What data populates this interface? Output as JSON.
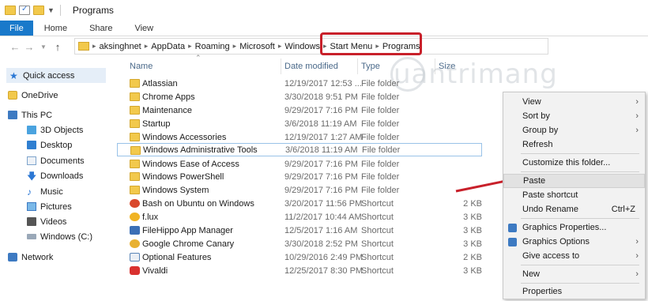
{
  "window": {
    "title": "Programs"
  },
  "ribbon": {
    "tabs": [
      "File",
      "Home",
      "Share",
      "View"
    ]
  },
  "address": {
    "crumbs": [
      "aksinghnet",
      "AppData",
      "Roaming",
      "Microsoft",
      "Windows",
      "Start Menu",
      "Programs"
    ]
  },
  "sidebar": {
    "items": [
      {
        "label": "Quick access",
        "icon": "star-icon"
      },
      {
        "label": "OneDrive",
        "icon": "onedrive-icon"
      },
      {
        "label": "This PC",
        "icon": "pc-icon"
      },
      {
        "label": "3D Objects",
        "icon": "cube-icon"
      },
      {
        "label": "Desktop",
        "icon": "desktop-icon"
      },
      {
        "label": "Documents",
        "icon": "documents-icon"
      },
      {
        "label": "Downloads",
        "icon": "download-icon"
      },
      {
        "label": "Music",
        "icon": "music-icon"
      },
      {
        "label": "Pictures",
        "icon": "pictures-icon"
      },
      {
        "label": "Videos",
        "icon": "videos-icon"
      },
      {
        "label": "Windows (C:)",
        "icon": "drive-icon"
      },
      {
        "label": "Network",
        "icon": "network-icon"
      }
    ]
  },
  "columns": {
    "name": "Name",
    "date": "Date modified",
    "type": "Type",
    "size": "Size"
  },
  "files": [
    {
      "name": "Atlassian",
      "date": "12/19/2017 12:53 ...",
      "type": "File folder",
      "size": ""
    },
    {
      "name": "Chrome Apps",
      "date": "3/30/2018 9:51 PM",
      "type": "File folder",
      "size": ""
    },
    {
      "name": "Maintenance",
      "date": "9/29/2017 7:16 PM",
      "type": "File folder",
      "size": ""
    },
    {
      "name": "Startup",
      "date": "3/6/2018 11:19 AM",
      "type": "File folder",
      "size": ""
    },
    {
      "name": "Windows Accessories",
      "date": "12/19/2017 1:27 AM",
      "type": "File folder",
      "size": ""
    },
    {
      "name": "Windows Administrative Tools",
      "date": "3/6/2018 11:19 AM",
      "type": "File folder",
      "size": ""
    },
    {
      "name": "Windows Ease of Access",
      "date": "9/29/2017 7:16 PM",
      "type": "File folder",
      "size": ""
    },
    {
      "name": "Windows PowerShell",
      "date": "9/29/2017 7:16 PM",
      "type": "File folder",
      "size": ""
    },
    {
      "name": "Windows System",
      "date": "9/29/2017 7:16 PM",
      "type": "File folder",
      "size": ""
    },
    {
      "name": "Bash on Ubuntu on Windows",
      "date": "3/20/2017 11:56 PM",
      "type": "Shortcut",
      "size": "2 KB"
    },
    {
      "name": "f.lux",
      "date": "11/2/2017 10:44 AM",
      "type": "Shortcut",
      "size": "3 KB"
    },
    {
      "name": "FileHippo App Manager",
      "date": "12/5/2017 1:16 AM",
      "type": "Shortcut",
      "size": "3 KB"
    },
    {
      "name": "Google Chrome Canary",
      "date": "3/30/2018 2:52 PM",
      "type": "Shortcut",
      "size": "3 KB"
    },
    {
      "name": "Optional Features",
      "date": "10/29/2016 2:49 PM",
      "type": "Shortcut",
      "size": "2 KB"
    },
    {
      "name": "Vivaldi",
      "date": "12/25/2017 8:30 PM",
      "type": "Shortcut",
      "size": "3 KB"
    }
  ],
  "watermark": "uantrimang",
  "context_menu": {
    "view": "View",
    "sort_by": "Sort by",
    "group_by": "Group by",
    "refresh": "Refresh",
    "customize": "Customize this folder...",
    "paste": "Paste",
    "paste_shortcut": "Paste shortcut",
    "undo_rename": "Undo Rename",
    "undo_shortcut": "Ctrl+Z",
    "graphics_properties": "Graphics Properties...",
    "graphics_options": "Graphics Options",
    "give_access": "Give access to",
    "new": "New",
    "properties": "Properties"
  },
  "colors": {
    "accent": "#1979ca",
    "highlight_red": "#c8202a",
    "folder": "#f2c94c"
  }
}
